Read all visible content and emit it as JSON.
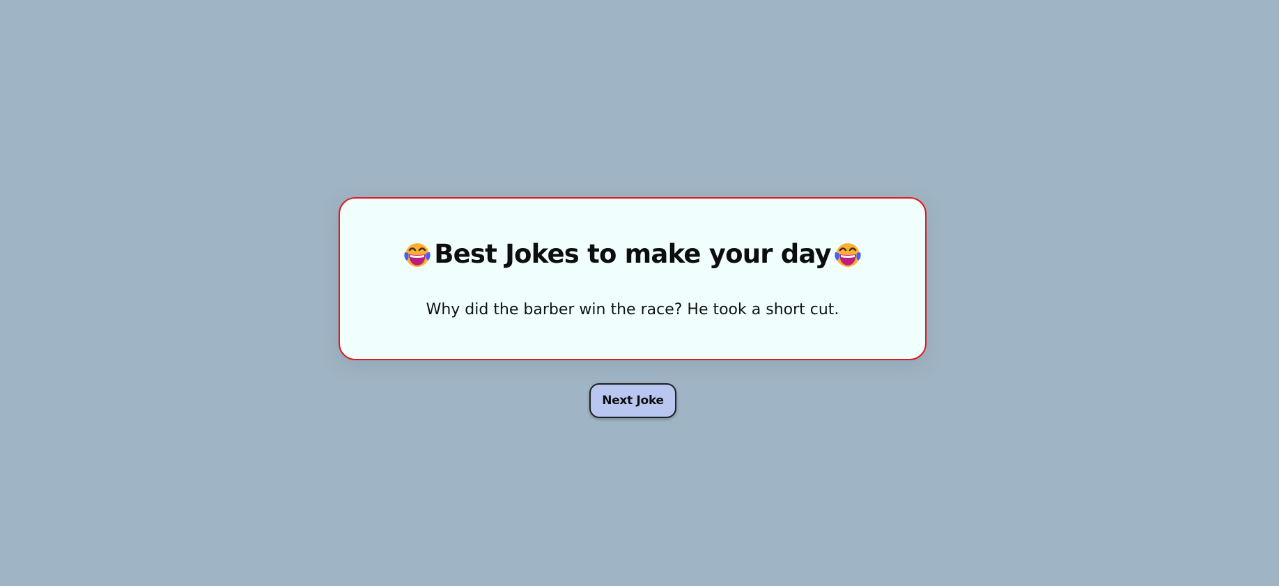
{
  "card": {
    "title": "Best Jokes to make your day",
    "title_icon": "face-with-tears-of-joy-icon",
    "joke": "Why did the barber win the race? He took a short cut."
  },
  "actions": {
    "next_label": "Next Joke"
  },
  "colors": {
    "background": "#9fb4c4",
    "card_background": "#f0fffe",
    "card_border": "#e01919",
    "button_background": "#b8c6f0"
  }
}
